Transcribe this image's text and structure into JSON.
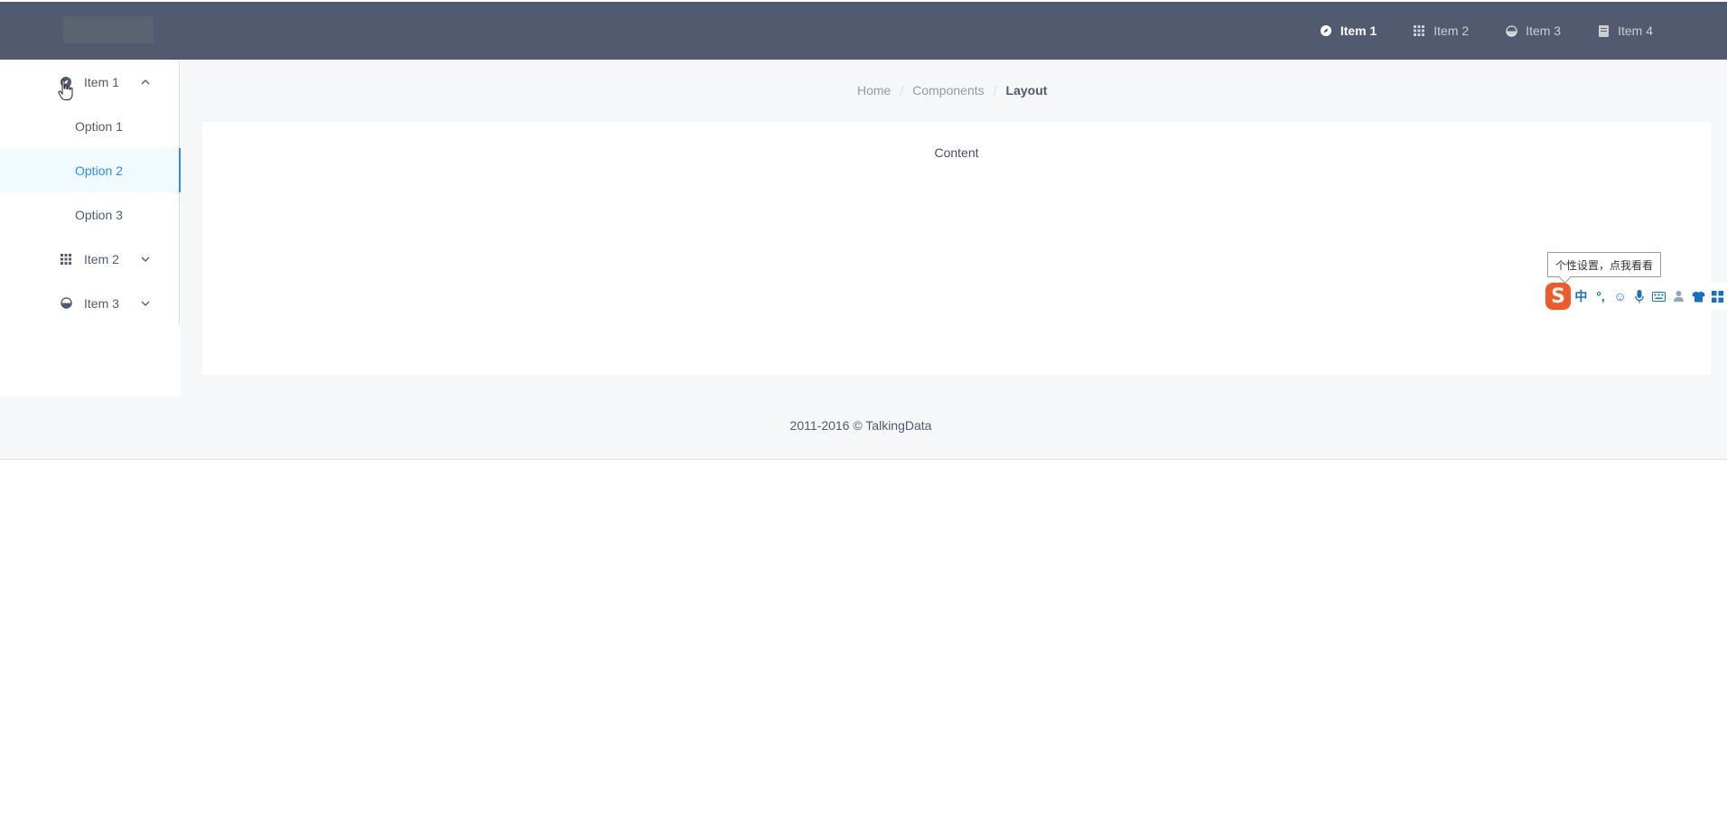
{
  "header": {
    "nav": [
      {
        "label": "Item 1",
        "icon": "compass-icon",
        "active": true
      },
      {
        "label": "Item 2",
        "icon": "grid-icon",
        "active": false
      },
      {
        "label": "Item 3",
        "icon": "pie-icon",
        "active": false
      },
      {
        "label": "Item 4",
        "icon": "book-icon",
        "active": false
      }
    ]
  },
  "sidebar": {
    "groups": [
      {
        "label": "Item 1",
        "icon": "compass-icon",
        "expanded": true,
        "options": [
          "Option 1",
          "Option 2",
          "Option 3"
        ],
        "active_option": "Option 2"
      },
      {
        "label": "Item 2",
        "icon": "grid-icon",
        "expanded": false
      },
      {
        "label": "Item 3",
        "icon": "pie-icon",
        "expanded": false
      }
    ]
  },
  "breadcrumb": {
    "items": [
      "Home",
      "Components",
      "Layout"
    ],
    "separator": "/"
  },
  "content": {
    "text": "Content"
  },
  "footer": {
    "text": "2011-2016 © TalkingData"
  },
  "ime": {
    "tooltip": "个性设置，点我看看",
    "logo": "S",
    "buttons": [
      "中",
      "°,",
      "☺",
      "🎤",
      "⌨",
      "👤",
      "👕",
      "▦"
    ]
  },
  "colors": {
    "header_bg": "#515a6e",
    "accent": "#2d8cf0",
    "layout_bg": "#f5f7f9"
  }
}
